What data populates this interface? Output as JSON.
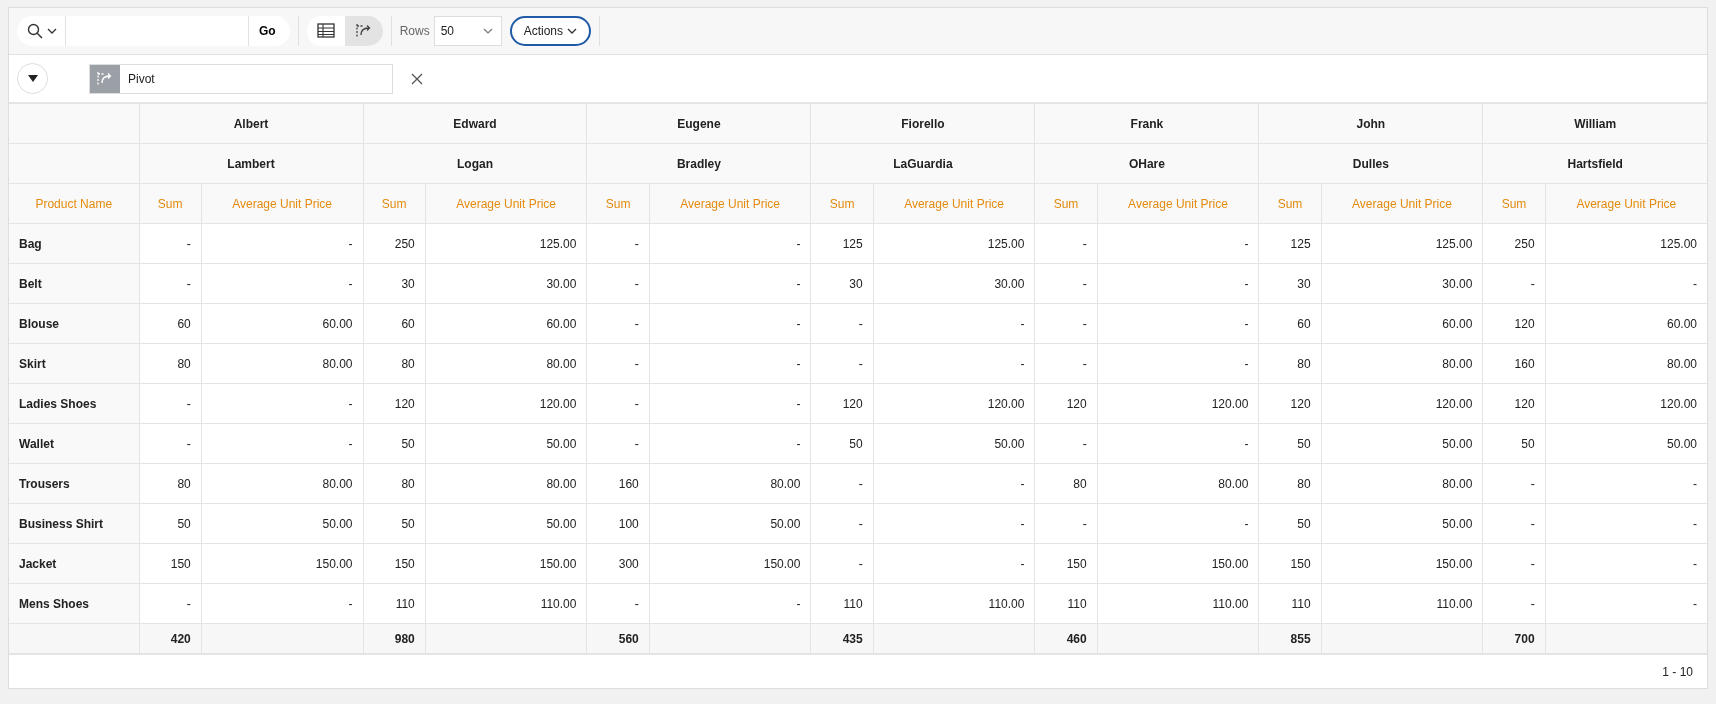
{
  "toolbar": {
    "go_button": "Go",
    "views": [
      {
        "kind": "grid",
        "selected": false
      },
      {
        "kind": "pivot",
        "selected": true
      }
    ],
    "rows_label": "Rows",
    "rows_value": "50",
    "actions_button": "Actions"
  },
  "pivot_bar": {
    "label": "Pivot"
  },
  "table": {
    "groups": [
      {
        "first": "Albert",
        "second": "Lambert",
        "total": "420"
      },
      {
        "first": "Edward",
        "second": "Logan",
        "total": "980"
      },
      {
        "first": "Eugene",
        "second": "Bradley",
        "total": "560"
      },
      {
        "first": "Fiorello",
        "second": "LaGuardia",
        "total": "435"
      },
      {
        "first": "Frank",
        "second": "OHare",
        "total": "460"
      },
      {
        "first": "John",
        "second": "Dulles",
        "total": "855"
      },
      {
        "first": "William",
        "second": "Hartsfield",
        "total": "700"
      }
    ],
    "row_header": "Product Name",
    "measures": [
      "Sum",
      "Average Unit Price",
      "Sum",
      "Average Unit Price",
      "Sum",
      "Average Unit Price",
      "Sum",
      "Average Unit Price",
      "Sum",
      "Average Unit Price",
      "Sum",
      "Average Unit Price",
      "Sum",
      "Average Unit Price"
    ],
    "rows": [
      {
        "name": "Bag",
        "cells": [
          "-",
          "-",
          "250",
          "125.00",
          "-",
          "-",
          "125",
          "125.00",
          "-",
          "-",
          "125",
          "125.00",
          "250",
          "125.00"
        ]
      },
      {
        "name": "Belt",
        "cells": [
          "-",
          "-",
          "30",
          "30.00",
          "-",
          "-",
          "30",
          "30.00",
          "-",
          "-",
          "30",
          "30.00",
          "-",
          "-"
        ]
      },
      {
        "name": "Blouse",
        "cells": [
          "60",
          "60.00",
          "60",
          "60.00",
          "-",
          "-",
          "-",
          "-",
          "-",
          "-",
          "60",
          "60.00",
          "120",
          "60.00"
        ]
      },
      {
        "name": "Skirt",
        "cells": [
          "80",
          "80.00",
          "80",
          "80.00",
          "-",
          "-",
          "-",
          "-",
          "-",
          "-",
          "80",
          "80.00",
          "160",
          "80.00"
        ]
      },
      {
        "name": "Ladies Shoes",
        "cells": [
          "-",
          "-",
          "120",
          "120.00",
          "-",
          "-",
          "120",
          "120.00",
          "120",
          "120.00",
          "120",
          "120.00",
          "120",
          "120.00"
        ]
      },
      {
        "name": "Wallet",
        "cells": [
          "-",
          "-",
          "50",
          "50.00",
          "-",
          "-",
          "50",
          "50.00",
          "-",
          "-",
          "50",
          "50.00",
          "50",
          "50.00"
        ]
      },
      {
        "name": "Trousers",
        "cells": [
          "80",
          "80.00",
          "80",
          "80.00",
          "160",
          "80.00",
          "-",
          "-",
          "80",
          "80.00",
          "80",
          "80.00",
          "-",
          "-"
        ]
      },
      {
        "name": "Business Shirt",
        "cells": [
          "50",
          "50.00",
          "50",
          "50.00",
          "100",
          "50.00",
          "-",
          "-",
          "-",
          "-",
          "50",
          "50.00",
          "-",
          "-"
        ]
      },
      {
        "name": "Jacket",
        "cells": [
          "150",
          "150.00",
          "150",
          "150.00",
          "300",
          "150.00",
          "-",
          "-",
          "150",
          "150.00",
          "150",
          "150.00",
          "-",
          "-"
        ]
      },
      {
        "name": "Mens Shoes",
        "cells": [
          "-",
          "-",
          "110",
          "110.00",
          "-",
          "-",
          "110",
          "110.00",
          "110",
          "110.00",
          "110",
          "110.00",
          "-",
          "-"
        ]
      }
    ]
  },
  "pagination": "1 - 10"
}
